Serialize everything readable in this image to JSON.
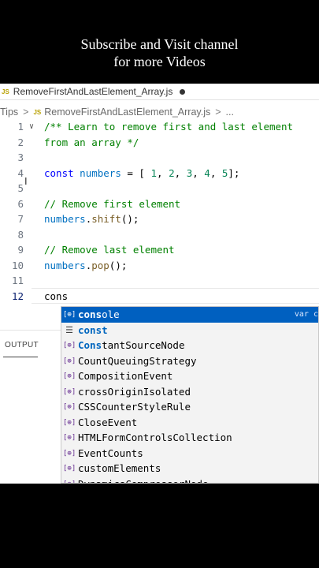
{
  "banner": {
    "line1": "Subscribe and Visit channel",
    "line2": "for more Videos"
  },
  "tab": {
    "icon": "JS",
    "filename": "RemoveFirstAndLastElement_Array.js"
  },
  "breadcrumb": {
    "folder": "Tips",
    "icon": "JS",
    "file": "RemoveFirstAndLastElement_Array.js",
    "more": "..."
  },
  "code": {
    "line_numbers": [
      "1",
      "2",
      "3",
      "4",
      "5",
      "6",
      "7",
      "8",
      "9",
      "10",
      "11",
      "12"
    ],
    "line1": "/** Learn to remove first and last element",
    "line2": "from an array */",
    "line4_kw": "const",
    "line4_var": "numbers",
    "line4_eq": " = [ ",
    "line4_n1": "1",
    "line4_n2": "2",
    "line4_n3": "3",
    "line4_n4": "4",
    "line4_n5": "5",
    "line4_end": "];",
    "line6": "// Remove first element",
    "line7_var": "numbers",
    "line7_fn": "shift",
    "line9": "// Remove last element",
    "line10_var": "numbers",
    "line10_fn": "pop",
    "line12": "cons"
  },
  "panel": {
    "output_tab": "OUTPUT"
  },
  "suggestions": {
    "selected_detail": "var c",
    "items": [
      {
        "bold": "cons",
        "rest": "ole",
        "icon": "variable-icon"
      },
      {
        "bold": "const",
        "rest": "",
        "icon": "keyword-icon"
      },
      {
        "bold": "Cons",
        "pre": "",
        "rest": "tantSourceNode",
        "icon": "variable-icon"
      },
      {
        "label": "CountQueuingStrategy",
        "icon": "variable-icon"
      },
      {
        "label": "CompositionEvent",
        "icon": "variable-icon"
      },
      {
        "label": "crossOriginIsolated",
        "icon": "variable-icon"
      },
      {
        "label": "CSSCounterStyleRule",
        "icon": "variable-icon"
      },
      {
        "label": "CloseEvent",
        "icon": "variable-icon"
      },
      {
        "label": "HTMLFormControlsCollection",
        "icon": "variable-icon"
      },
      {
        "label": "EventCounts",
        "icon": "variable-icon"
      },
      {
        "label": "customElements",
        "icon": "variable-icon"
      },
      {
        "label": "DynamicsCompressorNode",
        "icon": "variable-icon"
      }
    ]
  },
  "colors": {
    "selection": "#0060c0",
    "comment": "#008000",
    "keyword": "#0000ff",
    "variable": "#0070c1",
    "number": "#098658"
  }
}
